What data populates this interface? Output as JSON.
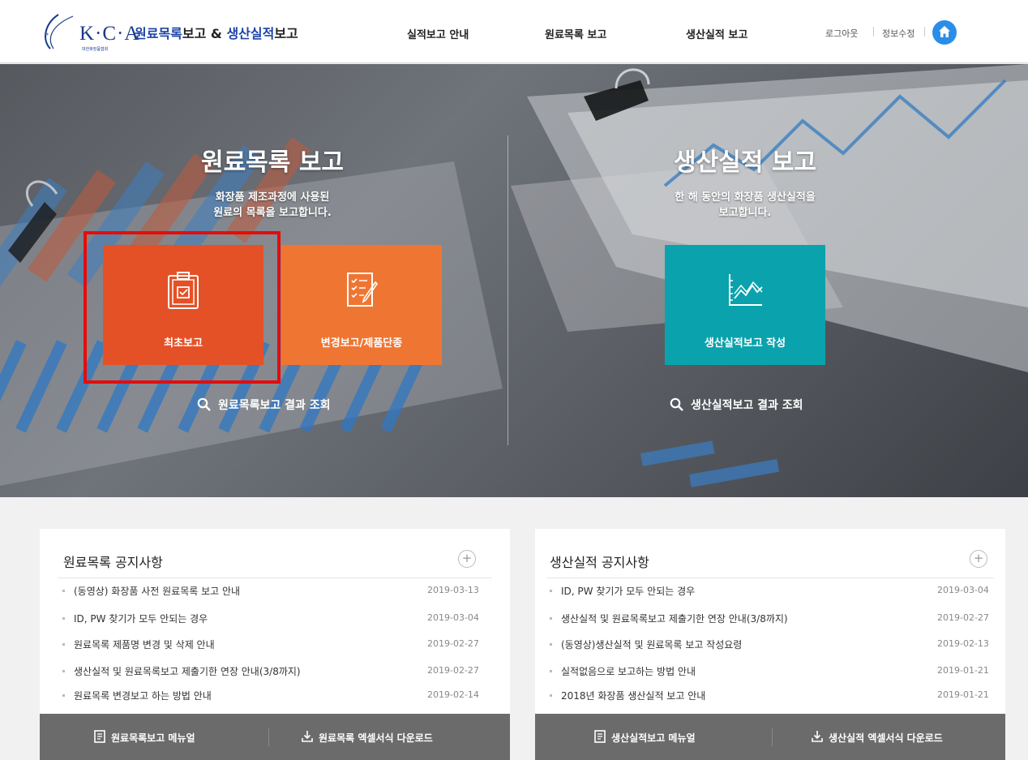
{
  "header": {
    "logo_text": "K·C·A",
    "logo_sub": "대한화장품협회",
    "title_part1": "원료목록",
    "title_part2": "보고 & ",
    "title_part3": "생산실적",
    "title_part4": "보고",
    "nav": [
      "실적보고 안내",
      "원료목록 보고",
      "생산실적 보고"
    ],
    "logout": "로그아웃",
    "edit_info": "정보수정"
  },
  "hero": {
    "left": {
      "title": "원료목록 보고",
      "desc_line1": "화장품 제조과정에 사용된",
      "desc_line2": "원료의 목록을 보고합니다.",
      "tile1_label": "최초보고",
      "tile2_label": "변경보고/제품단종",
      "search_label": "원료목록보고 결과 조회"
    },
    "right": {
      "title": "생산실적 보고",
      "desc_line1": "한 해 동안의 화장품 생산실적을",
      "desc_line2": "보고합니다.",
      "tile_label": "생산실적보고 작성",
      "search_label": "생산실적보고 결과 조회"
    }
  },
  "notices_left": {
    "title": "원료목록 공지사항",
    "plus": "+",
    "items": [
      {
        "title": "(동영상) 화장품 사전 원료목록 보고 안내",
        "date": "2019-03-13"
      },
      {
        "title": "ID, PW 찾기가 모두 안되는 경우",
        "date": "2019-03-04"
      },
      {
        "title": "원료목록 제품명 변경 및 삭제 안내",
        "date": "2019-02-27"
      },
      {
        "title": "생산실적 및 원료목록보고 제출기한 연장 안내(3/8까지)",
        "date": "2019-02-27"
      },
      {
        "title": "원료목록 변경보고 하는 방법 안내",
        "date": "2019-02-14"
      }
    ],
    "manual": "원료목록보고 메뉴얼",
    "download": "원료목록 엑셀서식 다운로드"
  },
  "notices_right": {
    "title": "생산실적 공지사항",
    "plus": "+",
    "items": [
      {
        "title": "ID, PW 찾기가 모두 안되는 경우",
        "date": "2019-03-04"
      },
      {
        "title": "생산실적 및 원료목록보고 제출기한 연장 안내(3/8까지)",
        "date": "2019-02-27"
      },
      {
        "title": "(동영상)생산실적 및 원료목록 보고 작성요령",
        "date": "2019-02-13"
      },
      {
        "title": "실적없음으로 보고하는 방법 안내",
        "date": "2019-01-21"
      },
      {
        "title": "2018년 화장품 생산실적 보고 안내",
        "date": "2019-01-21"
      }
    ],
    "manual": "생산실적보고 메뉴얼",
    "download": "생산실적 엑셀서식 다운로드"
  },
  "colors": {
    "tile_red": "#e55126",
    "tile_orange": "#ef7632",
    "tile_teal": "#0aa3ad",
    "highlight": "#e50c0c",
    "brand_blue": "#1e44a8"
  },
  "icons": [
    "home-icon",
    "clipboard-check-icon",
    "checklist-pen-icon",
    "chart-line-icon",
    "search-icon",
    "plus-icon",
    "manual-icon",
    "download-icon"
  ]
}
